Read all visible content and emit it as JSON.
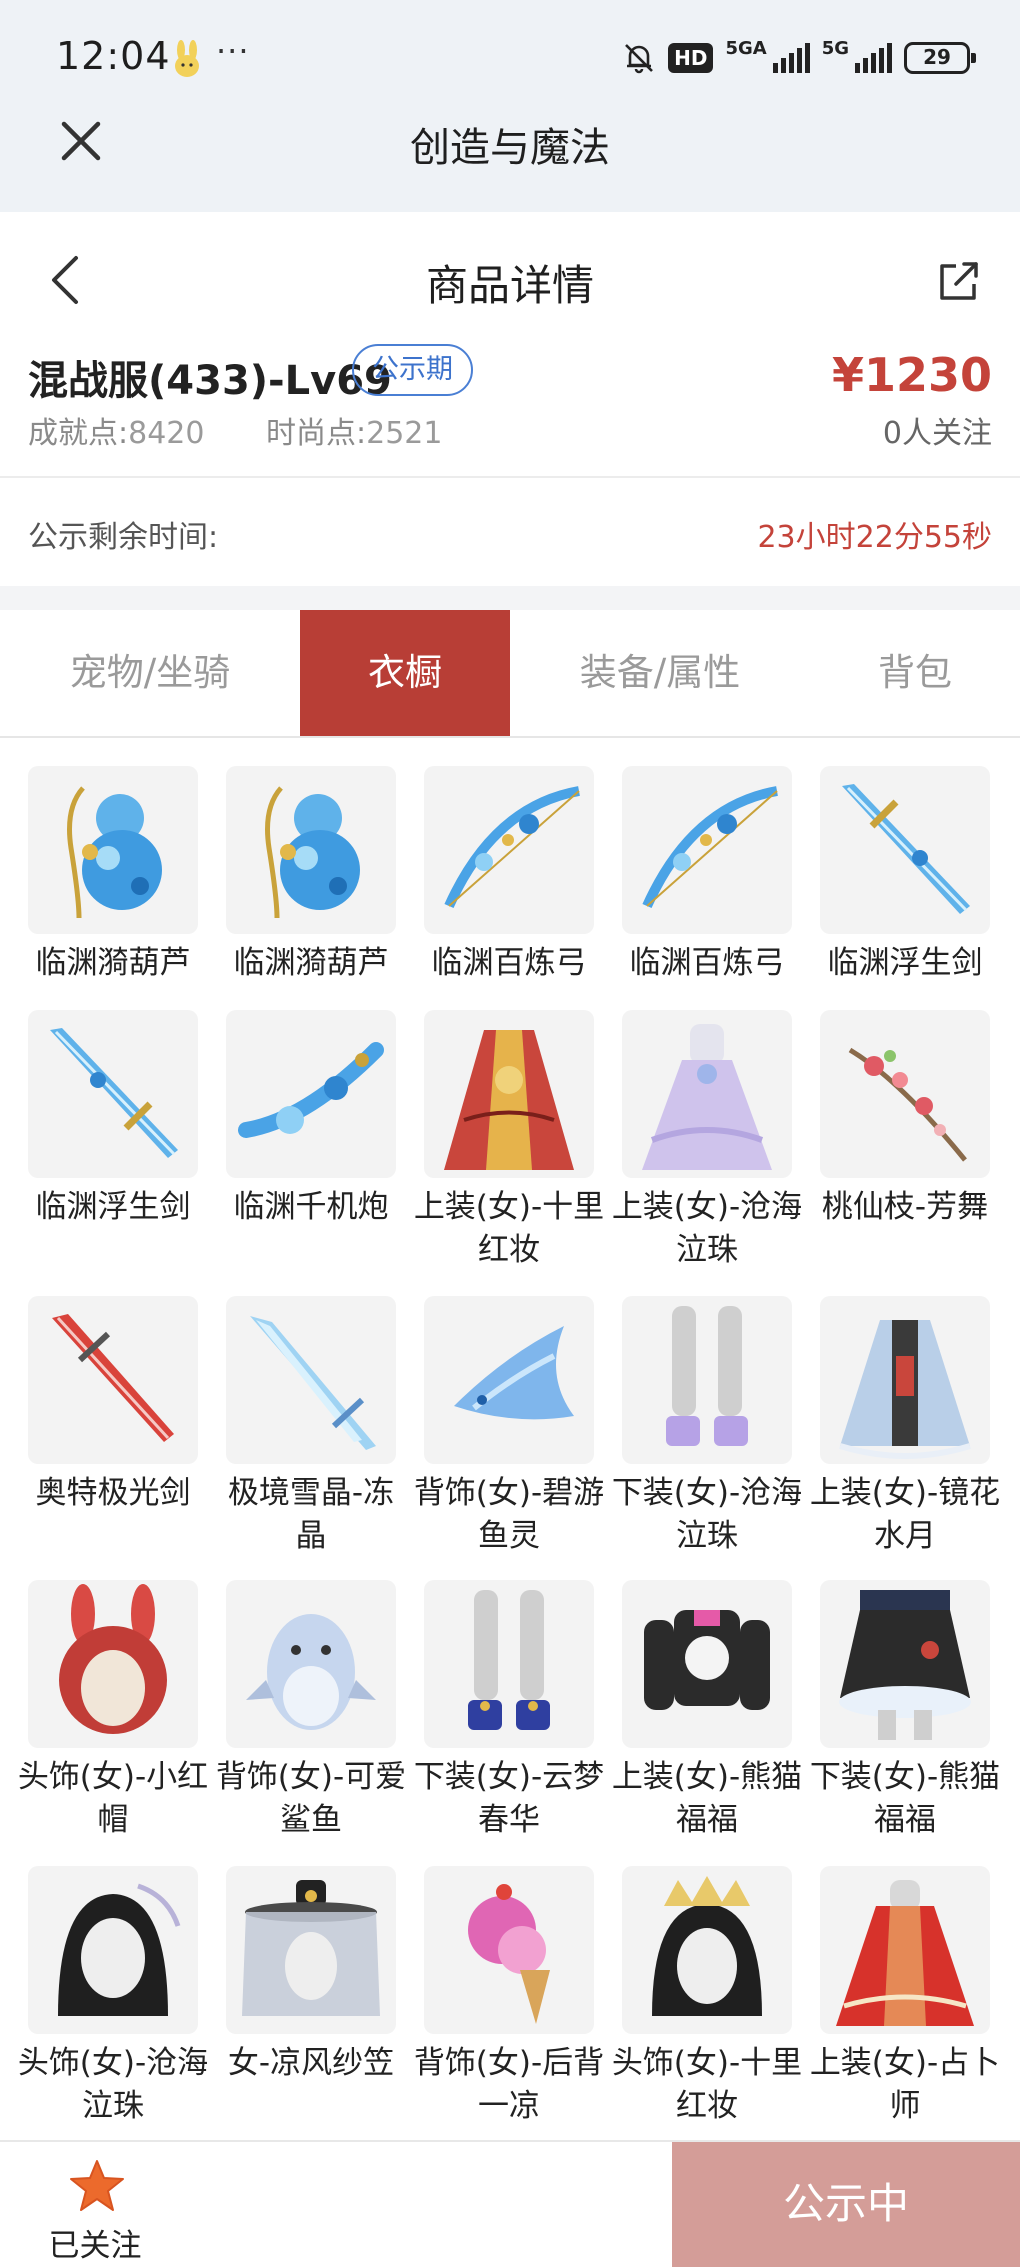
{
  "status_bar": {
    "time": "12:04",
    "more": "···",
    "hd_badge": "HD",
    "network_1": "5GA",
    "network_2": "5G",
    "battery": "29"
  },
  "app_bar": {
    "title": "创造与魔法"
  },
  "page": {
    "title": "商品详情"
  },
  "product": {
    "name": "混战服(433)-Lv69",
    "badge": "公示期",
    "achievement_label": "成就点:",
    "achievement_value": "8420",
    "fashion_label": "时尚点:",
    "fashion_value": "2521",
    "price": "¥1230",
    "followers": "0人关注"
  },
  "countdown": {
    "label": "公示剩余时间:",
    "value": "23小时22分55秒"
  },
  "tabs": [
    {
      "label": "宠物/坐骑",
      "active": false
    },
    {
      "label": "衣橱",
      "active": true
    },
    {
      "label": "装备/属性",
      "active": false
    },
    {
      "label": "背包",
      "active": false
    }
  ],
  "items": [
    {
      "name": "临渊漪葫芦",
      "icon": "gourd-icon"
    },
    {
      "name": "临渊漪葫芦",
      "icon": "gourd-icon"
    },
    {
      "name": "临渊百炼弓",
      "icon": "bow-icon"
    },
    {
      "name": "临渊百炼弓",
      "icon": "bow-icon"
    },
    {
      "name": "临渊浮生剑",
      "icon": "sword-icon"
    },
    {
      "name": "临渊浮生剑",
      "icon": "sword-icon"
    },
    {
      "name": "临渊千机炮",
      "icon": "cannon-icon"
    },
    {
      "name": "上装(女)-十里红妆",
      "icon": "red-robe-icon"
    },
    {
      "name": "上装(女)-沧海泣珠",
      "icon": "dress-icon"
    },
    {
      "name": "桃仙枝-芳舞",
      "icon": "peach-branch-icon"
    },
    {
      "name": "奥特极光剑",
      "icon": "red-sword-icon"
    },
    {
      "name": "极境雪晶-冻晶",
      "icon": "ice-crystal-icon"
    },
    {
      "name": "背饰(女)-碧游鱼灵",
      "icon": "fish-spirit-icon"
    },
    {
      "name": "下装(女)-沧海泣珠",
      "icon": "legs-icon"
    },
    {
      "name": "上装(女)-镜花水月",
      "icon": "top-outfit-icon"
    },
    {
      "name": "头饰(女)-小红帽",
      "icon": "red-hood-icon"
    },
    {
      "name": "背饰(女)-可爱鲨鱼",
      "icon": "shark-icon"
    },
    {
      "name": "下装(女)-云梦春华",
      "icon": "legs-icon"
    },
    {
      "name": "上装(女)-熊猫福福",
      "icon": "panda-top-icon"
    },
    {
      "name": "下装(女)-熊猫福福",
      "icon": "panda-skirt-icon"
    },
    {
      "name": "头饰(女)-沧海泣珠",
      "icon": "head-icon"
    },
    {
      "name": "女-凉风纱笠",
      "icon": "veil-hat-icon"
    },
    {
      "name": "背饰(女)-后背一凉",
      "icon": "ice-cream-icon"
    },
    {
      "name": "头饰(女)-十里红妆",
      "icon": "crown-head-icon"
    },
    {
      "name": "上装(女)-占卜师",
      "icon": "red-dress-icon"
    }
  ],
  "bottom": {
    "follow_label": "已关注",
    "cta_label": "公示中"
  },
  "colors": {
    "accent": "#b83e36",
    "price": "#c4433a",
    "cta": "#d49d98",
    "badge": "#3d73cc"
  }
}
